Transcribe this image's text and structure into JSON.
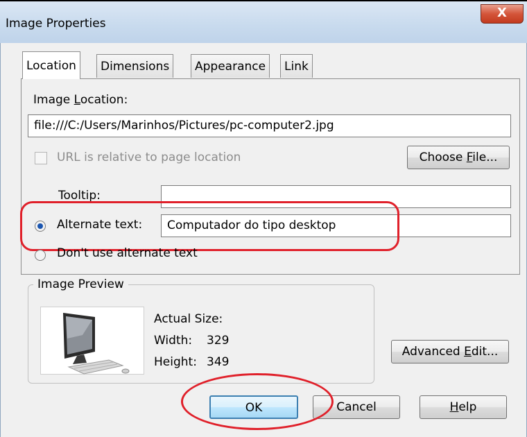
{
  "window": {
    "title": "Image Properties",
    "close_glyph": "X"
  },
  "tabs": [
    {
      "label": "Location",
      "active": true
    },
    {
      "label": "Dimensions",
      "active": false
    },
    {
      "label": "Appearance",
      "active": false
    },
    {
      "label": "Link",
      "active": false
    }
  ],
  "location": {
    "image_location_label_pre": "Image ",
    "image_location_label_key": "L",
    "image_location_label_post": "ocation:",
    "image_location_value": "file:///C:/Users/Marinhos/Pictures/pc-computer2.jpg",
    "relative_checkbox_label": "URL is relative to page location",
    "relative_checked": false,
    "choose_file_pre": "Choose ",
    "choose_file_key": "F",
    "choose_file_post": "ile...",
    "tooltip_label": "Tooltip:",
    "tooltip_value": "",
    "alt_text_label": "Alternate text:",
    "alt_text_value": "Computador do tipo desktop",
    "no_alt_text_label": "Don't use alternate text",
    "selected_option": "alternate-text"
  },
  "preview": {
    "legend": "Image Preview",
    "actual_size_label": "Actual Size:",
    "width_label": "Width:",
    "width_value": "329",
    "height_label": "Height:",
    "height_value": "349",
    "advanced_edit_pre": "Advanced ",
    "advanced_edit_key": "E",
    "advanced_edit_post": "dit..."
  },
  "footer": {
    "ok_label": "OK",
    "cancel_label": "Cancel",
    "help_key": "H",
    "help_post": "elp"
  },
  "colors": {
    "annotation_red": "#e0202a",
    "titlebar_blue": "#c9dbee",
    "dialog_face": "#f0f0f0",
    "radio_dot": "#1b56b0"
  }
}
